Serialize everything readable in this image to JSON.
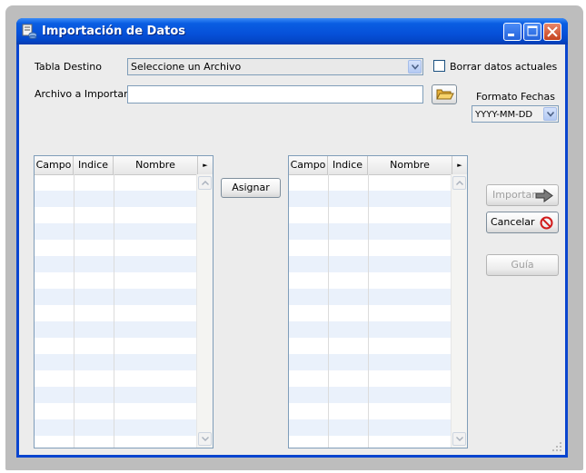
{
  "window": {
    "title": "Importación de Datos"
  },
  "form": {
    "tabla_destino_label": "Tabla Destino",
    "tabla_destino_value": "Seleccione un Archivo",
    "borrar_label": "Borrar datos actuales",
    "borrar_checked": false,
    "archivo_label": "Archivo a Importar",
    "archivo_value": "",
    "formato_label": "Formato Fechas",
    "formato_value": "YYYY-MM-DD"
  },
  "left_table": {
    "columns": [
      "Campo",
      "Indice",
      "Nombre"
    ],
    "rows": []
  },
  "right_table": {
    "columns": [
      "Campo",
      "Indice",
      "Nombre"
    ],
    "rows": []
  },
  "buttons": {
    "asignar": "Asignar",
    "importar": "Importar",
    "cancelar": "Cancelar",
    "guia": "Guía"
  },
  "icons": {
    "app": "database-import-icon",
    "folder": "folder-open-icon",
    "importar": "arrow-right-icon",
    "cancelar": "no-entry-icon"
  },
  "colors": {
    "titlebar": "#0a5ee3",
    "client": "#ececec",
    "alt_row": "#eaf1fb",
    "close_button": "#c4421f"
  }
}
